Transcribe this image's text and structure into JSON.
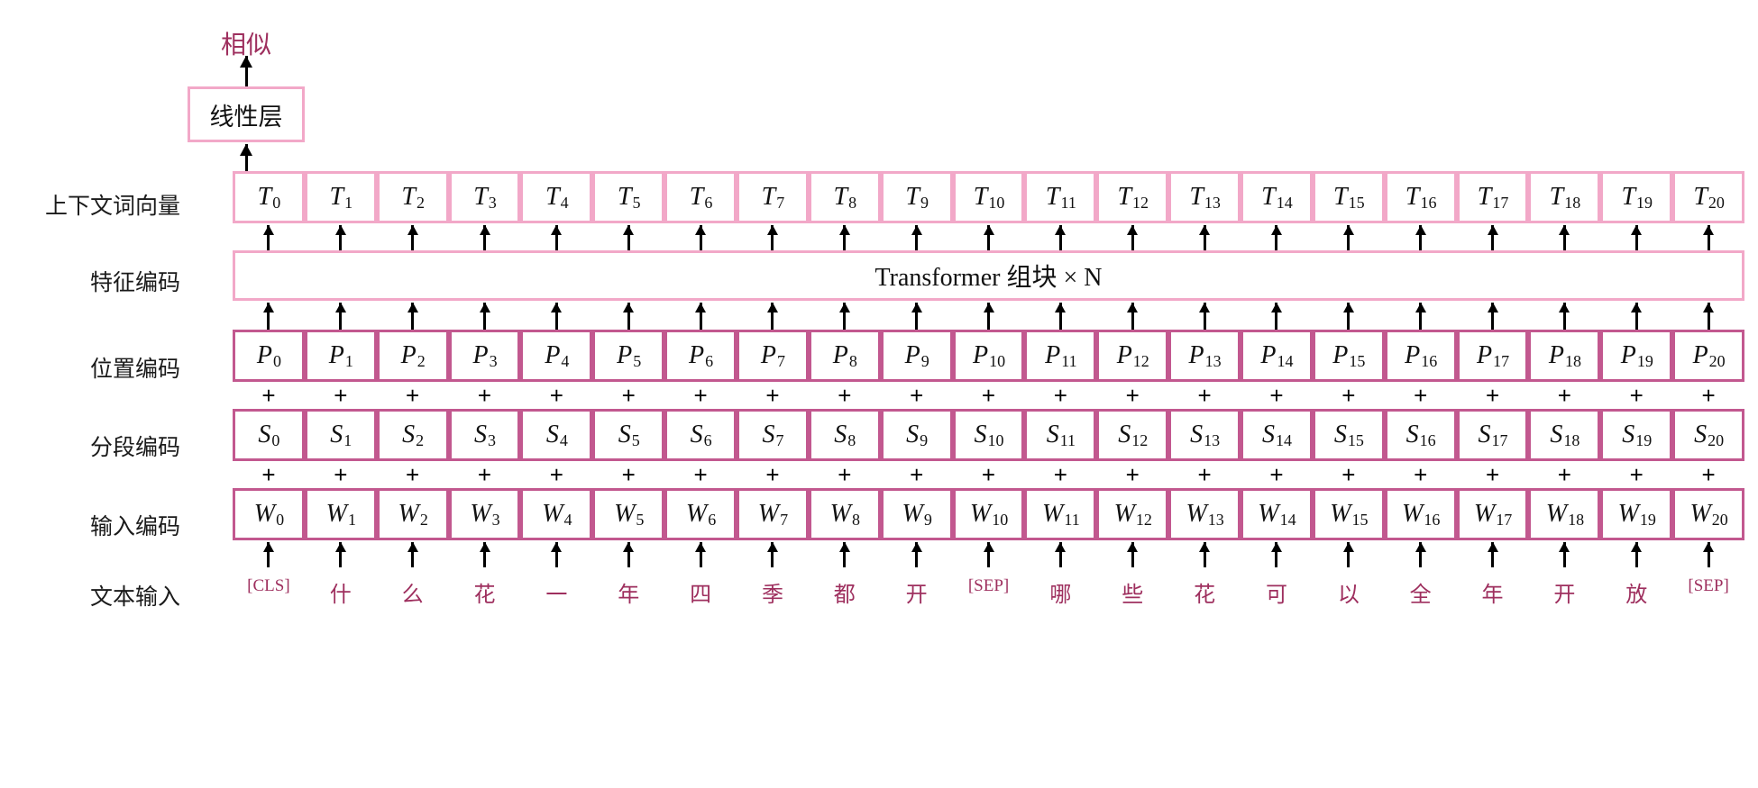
{
  "diagram": {
    "title_output": "相似",
    "linear_layer_label": "线性层",
    "transformer_label": "Transformer 组块 × N",
    "plus_symbol": "+",
    "colors": {
      "light_pink_border": "#f2a8c8",
      "dark_pink_border": "#c2588f",
      "token_text": "#9e2f5e",
      "label_text": "#1a1a1a",
      "arrow": "#000000",
      "background": "#ffffff"
    },
    "row_labels": {
      "context_vectors": "上下文词向量",
      "feature_encoding": "特征编码",
      "position_encoding": "位置编码",
      "segment_encoding": "分段编码",
      "input_encoding": "输入编码",
      "text_input": "文本输入"
    },
    "rows": {
      "T": [
        "T0",
        "T1",
        "T2",
        "T3",
        "T4",
        "T5",
        "T6",
        "T7",
        "T8",
        "T9",
        "T10",
        "T11",
        "T12",
        "T13",
        "T14",
        "T15",
        "T16",
        "T17",
        "T18",
        "T19",
        "T20"
      ],
      "P": [
        "P0",
        "P1",
        "P2",
        "P3",
        "P4",
        "P5",
        "P6",
        "P7",
        "P8",
        "P9",
        "P10",
        "P11",
        "P12",
        "P13",
        "P14",
        "P15",
        "P16",
        "P17",
        "P18",
        "P19",
        "P20"
      ],
      "S": [
        "S0",
        "S1",
        "S2",
        "S3",
        "S4",
        "S5",
        "S6",
        "S7",
        "S8",
        "S9",
        "S10",
        "S11",
        "S12",
        "S13",
        "S14",
        "S15",
        "S16",
        "S17",
        "S18",
        "S19",
        "S20"
      ],
      "W": [
        "W0",
        "W1",
        "W2",
        "W3",
        "W4",
        "W5",
        "W6",
        "W7",
        "W8",
        "W9",
        "W10",
        "W11",
        "W12",
        "W13",
        "W14",
        "W15",
        "W16",
        "W17",
        "W18",
        "W19",
        "W20"
      ]
    },
    "symbols": {
      "T": "T",
      "P": "P",
      "S": "S",
      "W": "W"
    },
    "subscripts": [
      "0",
      "1",
      "2",
      "3",
      "4",
      "5",
      "6",
      "7",
      "8",
      "9",
      "10",
      "11",
      "12",
      "13",
      "14",
      "15",
      "16",
      "17",
      "18",
      "19",
      "20"
    ],
    "tokens": [
      "[CLS]",
      "什",
      "么",
      "花",
      "一",
      "年",
      "四",
      "季",
      "都",
      "开",
      "[SEP]",
      "哪",
      "些",
      "花",
      "可",
      "以",
      "全",
      "年",
      "开",
      "放",
      "[SEP]"
    ],
    "token_count": 21
  }
}
